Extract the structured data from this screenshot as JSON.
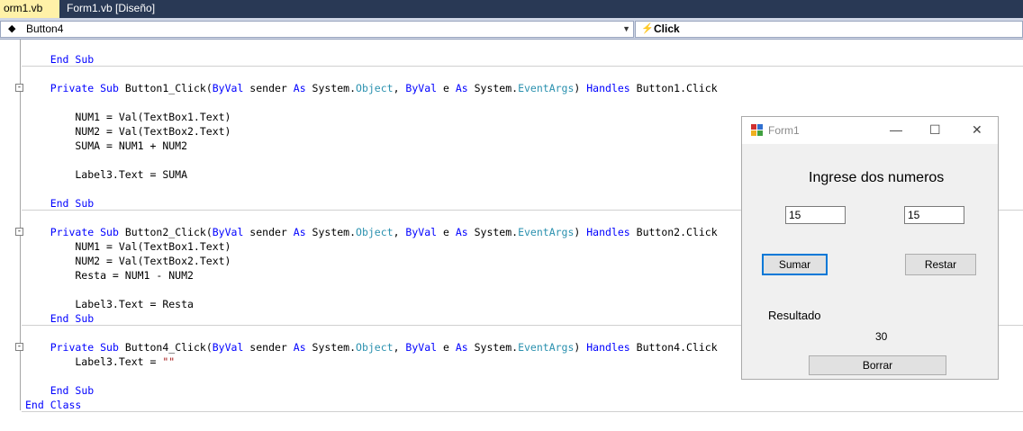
{
  "tabs": [
    {
      "label": "orm1.vb",
      "active": true
    },
    {
      "label": "Form1.vb [Diseño]",
      "active": false
    }
  ],
  "navbar": {
    "object": "Button4",
    "event": "Click"
  },
  "code": {
    "lines": [
      "    End Sub",
      "",
      "    Private Sub Button1_Click(ByVal sender As System.Object, ByVal e As System.EventArgs) Handles Button1.Click",
      "",
      "        NUM1 = Val(TextBox1.Text)",
      "        NUM2 = Val(TextBox2.Text)",
      "        SUMA = NUM1 + NUM2",
      "",
      "        Label3.Text = SUMA",
      "",
      "    End Sub",
      "",
      "    Private Sub Button2_Click(ByVal sender As System.Object, ByVal e As System.EventArgs) Handles Button2.Click",
      "        NUM1 = Val(TextBox1.Text)",
      "        NUM2 = Val(TextBox2.Text)",
      "        Resta = NUM1 - NUM2",
      "",
      "        Label3.Text = Resta",
      "    End Sub",
      "",
      "    Private Sub Button4_Click(ByVal sender As System.Object, ByVal e As System.EventArgs) Handles Button4.Click",
      "        Label3.Text = \"\"",
      "",
      "    End Sub",
      "End Class"
    ]
  },
  "form": {
    "title": "Form1",
    "heading": "Ingrese dos numeros",
    "textbox1": "15",
    "textbox2": "15",
    "sumar_label": "Sumar",
    "restar_label": "Restar",
    "resultado_label": "Resultado",
    "result_value": "30",
    "borrar_label": "Borrar",
    "minimize": "—",
    "maximize": "☐",
    "close": "✕"
  }
}
